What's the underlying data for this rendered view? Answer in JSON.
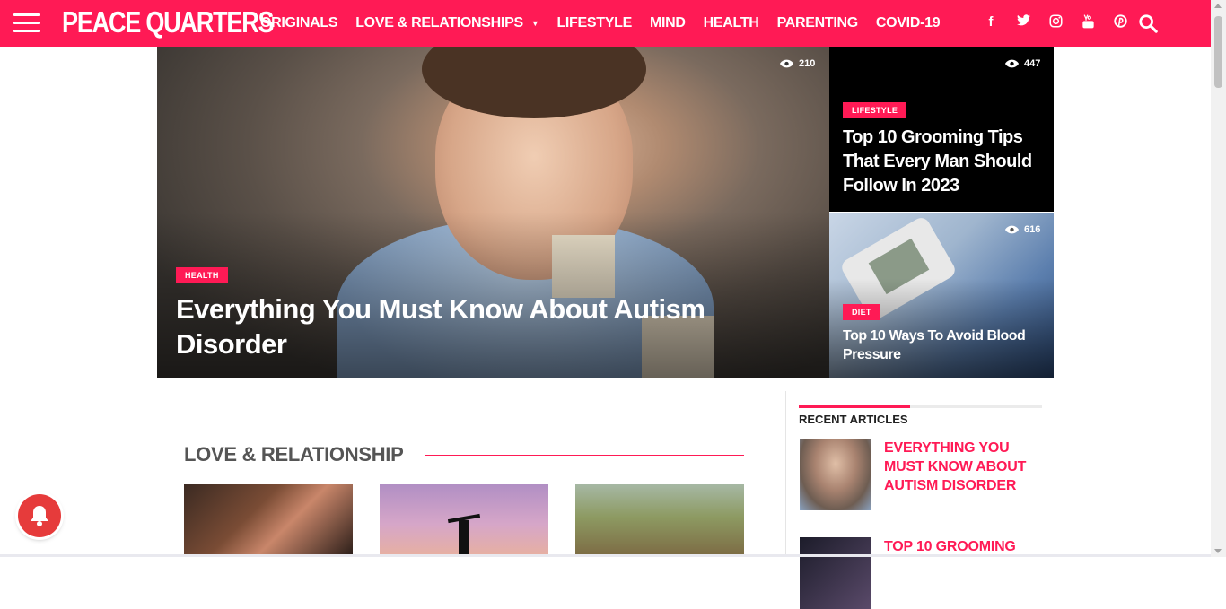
{
  "header": {
    "logo": "PEACE QUARTERS",
    "nav": [
      {
        "label": "ORIGINALS"
      },
      {
        "label": "LOVE & RELATIONSHIPS",
        "dropdown": true
      },
      {
        "label": "LIFESTYLE"
      },
      {
        "label": "MIND"
      },
      {
        "label": "HEALTH"
      },
      {
        "label": "PARENTING"
      },
      {
        "label": "COVID-19"
      }
    ],
    "social_icons": [
      "facebook-icon",
      "twitter-icon",
      "instagram-icon",
      "youtube-icon",
      "pinterest-icon"
    ],
    "search_icon": "search-icon",
    "brand_color": "#ff1a55"
  },
  "featured": {
    "main": {
      "views": "210",
      "category": "HEALTH",
      "title": "Everything You Must Know About Autism Disorder"
    },
    "side1": {
      "views": "447",
      "category": "LIFESTYLE",
      "title": "Top 10 Grooming Tips That Every Man Should Follow In 2023"
    },
    "side2": {
      "views": "616",
      "category": "DIET",
      "title": "Top 10 Ways To Avoid Blood Pressure"
    }
  },
  "section": {
    "title": "LOVE & RELATIONSHIP"
  },
  "sidebar": {
    "title": "RECENT ARTICLES",
    "items": [
      {
        "title": "EVERYTHING YOU MUST KNOW ABOUT AUTISM DISORDER"
      },
      {
        "title": "TOP 10 GROOMING"
      }
    ]
  }
}
